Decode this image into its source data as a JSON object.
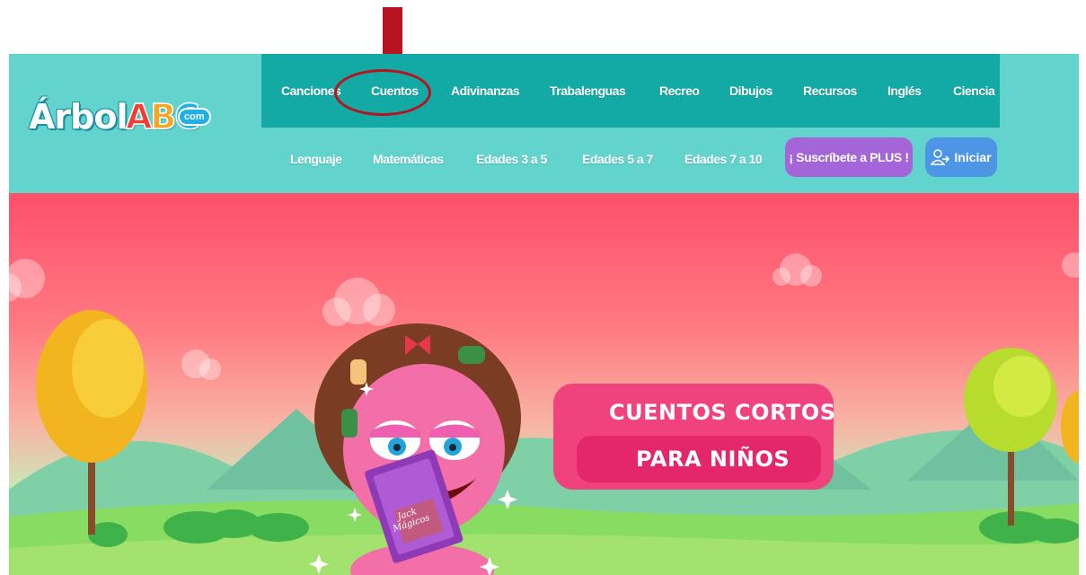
{
  "brand": {
    "logo_word": "Árbol",
    "logo_a": "A",
    "logo_b": "B",
    "logo_c": "C",
    "logo_suffix": "com"
  },
  "nav_primary": [
    "Canciones",
    "Cuentos",
    "Adivinanzas",
    "Trabalenguas",
    "Recreo",
    "Dibujos",
    "Recursos",
    "Inglés",
    "Ciencia"
  ],
  "nav_secondary": [
    "Lenguaje",
    "Matemáticas",
    "Edades 3 a 5",
    "Edades 5 a 7",
    "Edades 7 a 10"
  ],
  "buttons": {
    "plus": "¡ Suscríbete a PLUS !",
    "login": "Iniciar"
  },
  "hero": {
    "title_line1": "CUENTOS CORTOS",
    "title_line2": "PARA NIÑOS",
    "book_title": "Jack Mágicos"
  },
  "colors": {
    "header": "#62d3cd",
    "topnav": "#13aaa5",
    "plus_button": "#a465d8",
    "login_button": "#4c96e5",
    "hero_title": "#f0427d",
    "annotation": "#b81320"
  },
  "icons": [
    "down-arrow-annotation",
    "highlight-circle-annotation",
    "user-login-icon"
  ]
}
